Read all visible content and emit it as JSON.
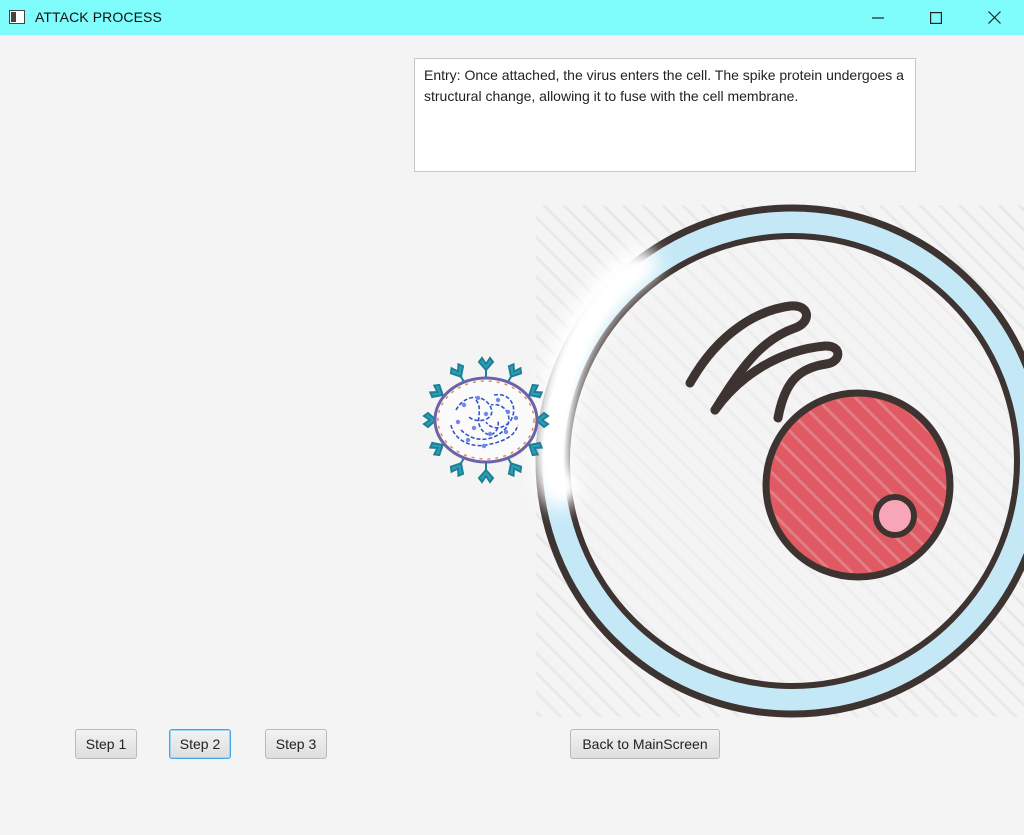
{
  "window": {
    "title": "ATTACK PROCESS",
    "accent_color": "#7ffcfc"
  },
  "description": {
    "text": "Entry: Once attached, the virus enters the cell. The spike protein undergoes a structural change, allowing it to fuse with the cell membrane."
  },
  "scene": {
    "cell_membrane_color": "#c5e8f7",
    "cell_outline_color": "#3d3330",
    "nucleus_color": "#e05a63",
    "nucleolus_color": "#f6a6b7",
    "virus_spike_color": "#2aa0b8",
    "virus_membrane_color": "#7a6fb0",
    "virus_rna_color": "#3355cc"
  },
  "buttons": {
    "step1": "Step 1",
    "step2": "Step 2",
    "step3": "Step 3",
    "back": "Back to MainScreen"
  },
  "selected_step": "Step 2"
}
